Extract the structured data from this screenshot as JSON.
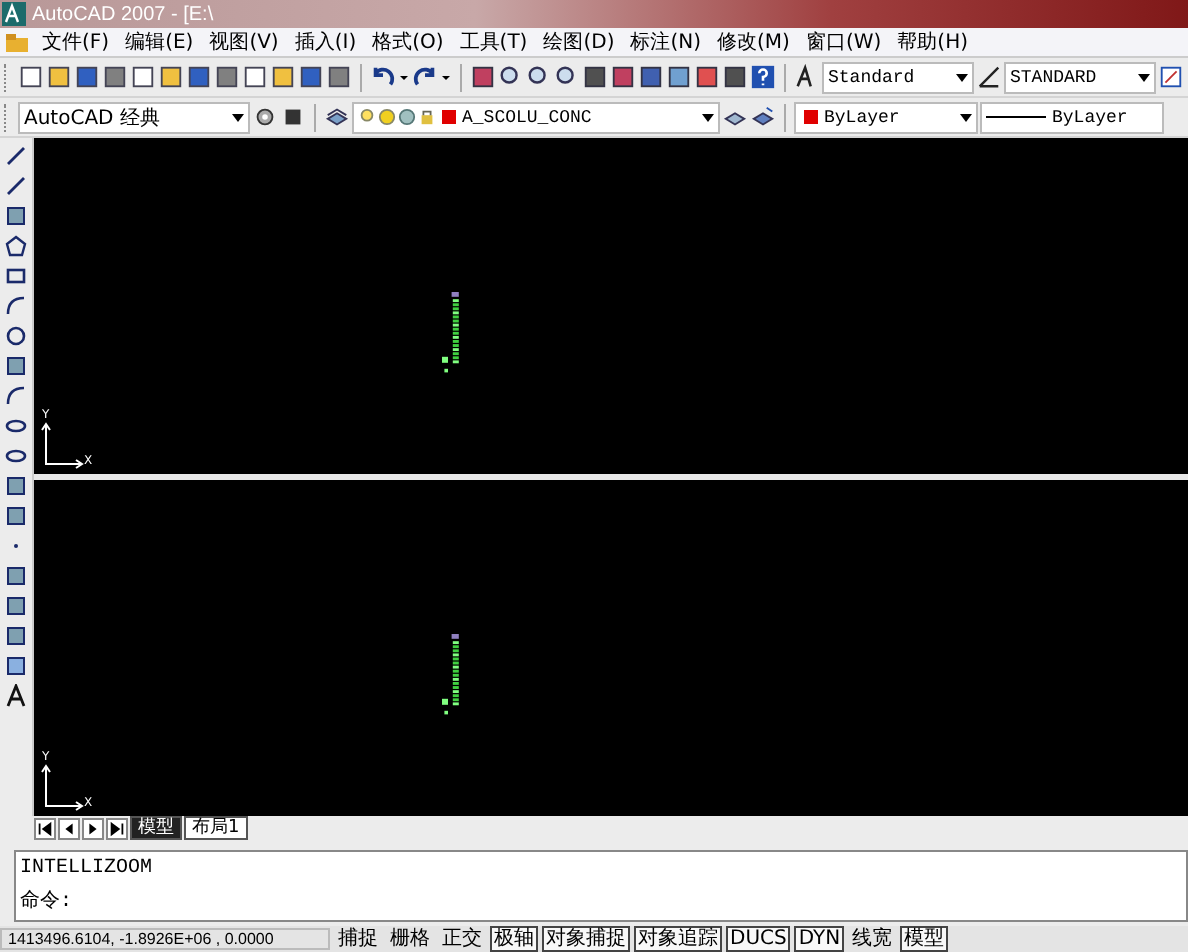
{
  "window": {
    "title": "AutoCAD 2007 - [E:\\"
  },
  "menu": [
    "文件(F)",
    "编辑(E)",
    "视图(V)",
    "插入(I)",
    "格式(O)",
    "工具(T)",
    "绘图(D)",
    "标注(N)",
    "修改(M)",
    "窗口(W)",
    "帮助(H)"
  ],
  "toolbar": {
    "text_style": "Standard",
    "dim_style": "STANDARD"
  },
  "toolbar2": {
    "workspace": "AutoCAD 经典",
    "layer": "A_SCOLU_CONC",
    "color_setting": "ByLayer",
    "linetype": "ByLayer"
  },
  "viewports": [
    {
      "ucs_y": "Y",
      "ucs_x": "X"
    },
    {
      "ucs_y": "Y",
      "ucs_x": "X"
    }
  ],
  "tabs": [
    {
      "label": "模型",
      "selected": true
    },
    {
      "label": "布局1",
      "selected": false
    }
  ],
  "command": {
    "history": "INTELLIZOOM",
    "prompt": "命令:"
  },
  "status_bar": {
    "coordinates": "1413496.6104, -1.8926E+06 , 0.0000",
    "toggles": [
      {
        "label": "捕捉",
        "on": false
      },
      {
        "label": "栅格",
        "on": false
      },
      {
        "label": "正交",
        "on": false
      },
      {
        "label": "极轴",
        "on": true
      },
      {
        "label": "对象捕捉",
        "on": true
      },
      {
        "label": "对象追踪",
        "on": true
      },
      {
        "label": "DUCS",
        "on": true
      },
      {
        "label": "DYN",
        "on": true
      },
      {
        "label": "线宽",
        "on": false
      },
      {
        "label": "模型",
        "on": true
      }
    ]
  }
}
